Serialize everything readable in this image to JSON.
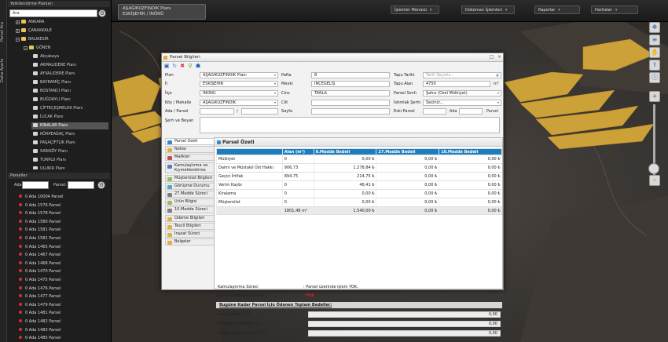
{
  "sidebar": {
    "vertical_tabs": [
      "Parsel Ara",
      "Daha Ayarla"
    ],
    "tree_header": "Yetkilendirme Planları",
    "il_select": "Ara",
    "tree_items": [
      {
        "label": "ANKARA",
        "type": "folder",
        "level": 1
      },
      {
        "label": "ÇANAKKALE",
        "type": "folder",
        "level": 1
      },
      {
        "label": "BALIKESİR",
        "type": "folder",
        "level": 1
      },
      {
        "label": "GÖNEN",
        "type": "folder",
        "level": 2
      },
      {
        "label": "Akçakaya",
        "type": "plan"
      },
      {
        "label": "AKMALIDERE Planı",
        "type": "plan"
      },
      {
        "label": "AYVALIDERE Planı",
        "type": "plan"
      },
      {
        "label": "BAYRAMİÇ Planı",
        "type": "plan"
      },
      {
        "label": "BOSTANCI Planı",
        "type": "plan"
      },
      {
        "label": "BUĞDAYLI Planı",
        "type": "plan"
      },
      {
        "label": "ÇİFTEÇEŞMELER Planı",
        "type": "plan"
      },
      {
        "label": "İLICAK Planı",
        "type": "plan"
      },
      {
        "label": "KINALAR Planı",
        "type": "plan",
        "selected": true
      },
      {
        "label": "KÖRPEAĞAÇ Planı",
        "type": "plan"
      },
      {
        "label": "PAŞAÇİFTLİK Planı",
        "type": "plan"
      },
      {
        "label": "SARIKÖY Planı",
        "type": "plan"
      },
      {
        "label": "TURPLU Planı",
        "type": "plan"
      },
      {
        "label": "ULUKIR Planı",
        "type": "plan"
      }
    ],
    "parcel_header": "Parseller",
    "filter_ada_label": "Ada:",
    "filter_parsel_label": "Parsel:",
    "parcels": [
      "0 Ada 10004 Parsel",
      "0 Ada 1576 Parsel",
      "0 Ada 1578 Parsel",
      "0 Ada 1580 Parsel",
      "0 Ada 1581 Parsel",
      "0 Ada 1582 Parsel",
      "0 Ada 1465 Parsel",
      "0 Ada 1467 Parsel",
      "0 Ada 1468 Parsel",
      "0 Ada 1470 Parsel",
      "0 Ada 1475 Parsel",
      "0 Ada 1476 Parsel",
      "0 Ada 1477 Parsel",
      "0 Ada 1479 Parsel",
      "0 Ada 1481 Parsel",
      "0 Ada 1482 Parsel",
      "0 Ada 1483 Parsel",
      "0 Ada 1485 Parsel"
    ]
  },
  "topbar": {
    "plan_title_line1": "AŞAĞIKUZFINDIK Planı",
    "plan_title_line2": "ESKİŞEHİR / İNÖNÜ",
    "menus": [
      "İşlemler Menüsü",
      "Doküman İşlemleri",
      "Raporlar",
      "Haritalar"
    ]
  },
  "dialog": {
    "title": "Parsel Bilgileri",
    "fields": {
      "plan_label": "Plan",
      "plan_value": "AŞAĞIKUZFINDIK Planı",
      "il_label": "İl",
      "il_value": "ESKİŞEHİR",
      "ilce_label": "İlçe",
      "ilce_value": "İNÖNÜ",
      "koy_label": "Köy / Mahalle",
      "koy_value": "AŞAĞIKUZFINDIK",
      "ada_label": "Ada / Parsel",
      "ada_sep": "/",
      "serh_label": "Şerh ve Beyan",
      "pafta_label": "Pafta",
      "pafta_value": "8",
      "mevki_label": "Mevki",
      "mevki_value": "İNCEGELİŞ",
      "cins_label": "Cins",
      "cins_value": "TARLA",
      "cilt_label": "Cilt",
      "sayfa_label": "Sayfa",
      "tapu_tarihi_label": "Tapu Tarihi",
      "tapu_tarihi_placeholder": "Tarih Seçiniz...",
      "tapu_alan_label": "Tapu Alan",
      "tapu_alan_value": "4750",
      "tapu_alan_unit": "m²",
      "parsel_sinifi_label": "Parsel Sınıfı",
      "parsel_sinifi_value": "Şahıs (Özel Mülkiyet)",
      "istimlak_label": "İstimlak Şerhi",
      "istimlak_value": "Seçiniz...",
      "eski_parsel_label": "Eski Parsel",
      "eski_ada_label": "Ada",
      "eski_parsel_label2": "Parsel"
    },
    "tabs": [
      {
        "label": "Parsel Özeti",
        "active": true,
        "color": "#3a88c8"
      },
      {
        "label": "Notlar",
        "color": "#e0b040"
      },
      {
        "label": "Malikler",
        "color": "#c0504d"
      },
      {
        "label": "Kamulaştırma ve Kıymetlendirme",
        "color": "#4f81bd",
        "two": true
      },
      {
        "label": "Müştemilat Bilgileri",
        "color": "#9bbb59"
      },
      {
        "label": "Görüşme Durumu",
        "color": "#4bacc6"
      },
      {
        "label": "27.Madde Süreci",
        "color": "#7f7f7f"
      },
      {
        "label": "Ürün Bilgisi",
        "color": "#9bbb59"
      },
      {
        "label": "10.Madde Süreci",
        "color": "#7f7f7f"
      },
      {
        "label": "Ödeme Bilgileri",
        "color": "#e0b040"
      },
      {
        "label": "Tescil Bilgileri",
        "color": "#e0b040"
      },
      {
        "label": "İnşaat Süreci",
        "color": "#e0b040"
      },
      {
        "label": "Belgeler",
        "color": "#e0b040"
      }
    ],
    "content_title": "Parsel Özeti",
    "table": {
      "headers": [
        "",
        "Alan (m²)",
        "8.Madde Bedeli",
        "27.Madde Bedeli",
        "10.Madde Bedeli"
      ],
      "rows": [
        [
          "Mülkiyet",
          "0",
          "0,00 ₺",
          "0,00 ₺",
          "0,00 ₺"
        ],
        [
          "Daimi ve Müstakil Üst Hakkı",
          "906,73",
          "1.278,84 ₺",
          "0,00 ₺",
          "0,00 ₺"
        ],
        [
          "Geçici İrtifak",
          "894,75",
          "214,75 ₺",
          "0,00 ₺",
          "0,00 ₺"
        ],
        [
          "Verim Kaybı",
          "0",
          "46,41 ₺",
          "0,00 ₺",
          "0,00 ₺"
        ],
        [
          "Kiralama",
          "0",
          "0,00 ₺",
          "0,00 ₺",
          "0,00 ₺"
        ],
        [
          "Müştemilat",
          "0",
          "0,00 ₺",
          "0,00 ₺",
          "0,00 ₺"
        ]
      ],
      "total": [
        "",
        "1801,48 m²",
        "1.540,00 ₺",
        "0,00 ₺",
        "0,00 ₺"
      ]
    },
    "kamulastirma_label": "Kamulaştırma Süreci",
    "kamulastirma_value": ": Parsel üzerinde işlem YOK.",
    "kullanici_label": "Parsel Üzerinde Kullanıcı",
    "kullanici_value": ": Yok",
    "paid_header": "Bugüne Kadar Parsel İçin Ödenen Toplam Bedeller:",
    "paid_rows": [
      {
        "label": "Arazi Bedeli (TL)",
        "value": "0,00"
      },
      {
        "label": "Müştemilat Bedeli (TL)",
        "value": "0,00"
      },
      {
        "label": "Zarar - Ziyan Bedeli (TL)",
        "value": "0,00"
      }
    ]
  },
  "colors": {
    "table_header": "#1b7fbf",
    "map_parcel": "#e5b43a",
    "status_red": "#c62828"
  }
}
